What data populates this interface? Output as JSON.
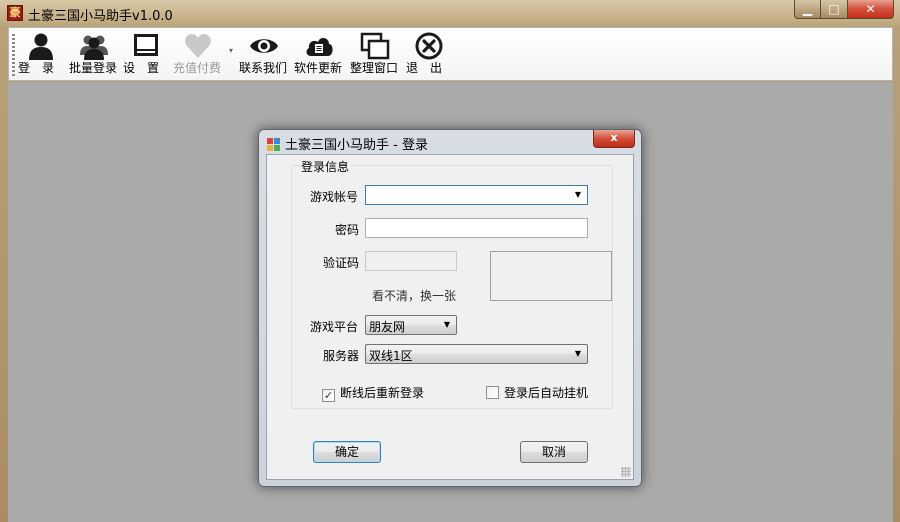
{
  "app": {
    "title": "土豪三国小马助手v1.0.0",
    "icon_glyph": "豪"
  },
  "window_controls": {
    "minimize": "▁",
    "maximize": "□",
    "close": "✕"
  },
  "toolbar": {
    "buttons": [
      {
        "label": "登　录",
        "icon": "user-icon"
      },
      {
        "label": "批量登录",
        "icon": "users-icon"
      },
      {
        "label": "设　置",
        "icon": "monitor-icon"
      },
      {
        "label": "充值付费",
        "icon": "heart-icon",
        "disabled": true
      },
      {
        "label": "联系我们",
        "icon": "eye-icon"
      },
      {
        "label": "软件更新",
        "icon": "cloud-icon"
      },
      {
        "label": "整理窗口",
        "icon": "windows-icon"
      },
      {
        "label": "退　出",
        "icon": "close-circle-icon"
      }
    ],
    "dropdown_arrow": "▾"
  },
  "dialog": {
    "title": "土豪三国小马助手 - 登录",
    "close_glyph": "x",
    "group_title": "登录信息",
    "account": {
      "label": "游戏帐号",
      "value": ""
    },
    "password": {
      "label": "密码",
      "value": ""
    },
    "captcha": {
      "label": "验证码",
      "value": "",
      "refresh_text": "看不清，换一张"
    },
    "platform": {
      "label": "游戏平台",
      "value": "朋友网"
    },
    "server": {
      "label": "服务器",
      "value": "双线1区"
    },
    "reconnect": {
      "label": "断线后重新登录",
      "checked": true,
      "mark": "✓"
    },
    "auto_hook": {
      "label": "登录后自动挂机",
      "checked": false,
      "mark": ""
    },
    "ok_label": "确定",
    "cancel_label": "取消"
  },
  "colors": {
    "frame": "#b9a27a",
    "client_bg": "#aaaaaa",
    "close_red": "#d24f39",
    "focus_blue": "#3d7bad"
  }
}
